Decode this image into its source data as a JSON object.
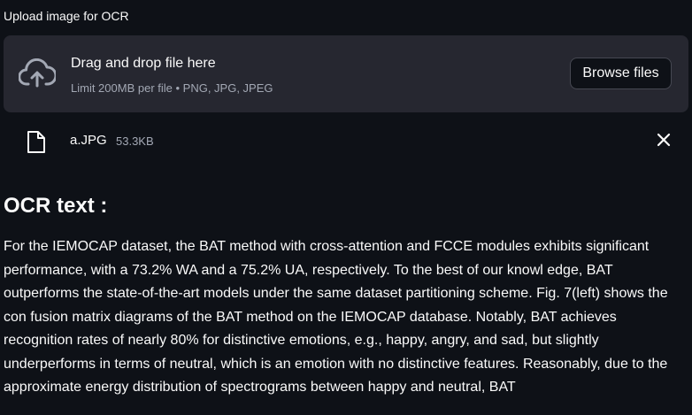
{
  "uploader": {
    "label": "Upload image for OCR",
    "dropzone_title": "Drag and drop file here",
    "dropzone_hint": "Limit 200MB per file • PNG, JPG, JPEG",
    "browse_label": "Browse files",
    "upload_icon": "cloud-upload-icon"
  },
  "file": {
    "name": "a.JPG",
    "size": "53.3KB",
    "file_icon": "file-icon",
    "remove_icon": "close-icon"
  },
  "ocr": {
    "heading": "OCR text :",
    "text": "For the IEMOCAP dataset, the BAT method with cross-attention and FCCE modules exhibits significant performance, with a 73.2% WA and a 75.2% UA, respectively. To the best of our knowl edge, BAT outperforms the state-of-the-art models under the same dataset partitioning scheme. Fig. 7(left) shows the con fusion matrix diagrams of the BAT method on the IEMOCAP database. Notably, BAT achieves recognition rates of nearly 80% for distinctive emotions, e.g., happy, angry, and sad, but slightly underperforms in terms of neutral, which is an emotion with no distinctive features. Reasonably, due to the approximate energy distribution of spectrograms between happy and neutral, BAT"
  },
  "colors": {
    "background": "#0e1117",
    "dropzone": "#262730",
    "text": "#fafafa",
    "muted": "#a3a8b4"
  }
}
